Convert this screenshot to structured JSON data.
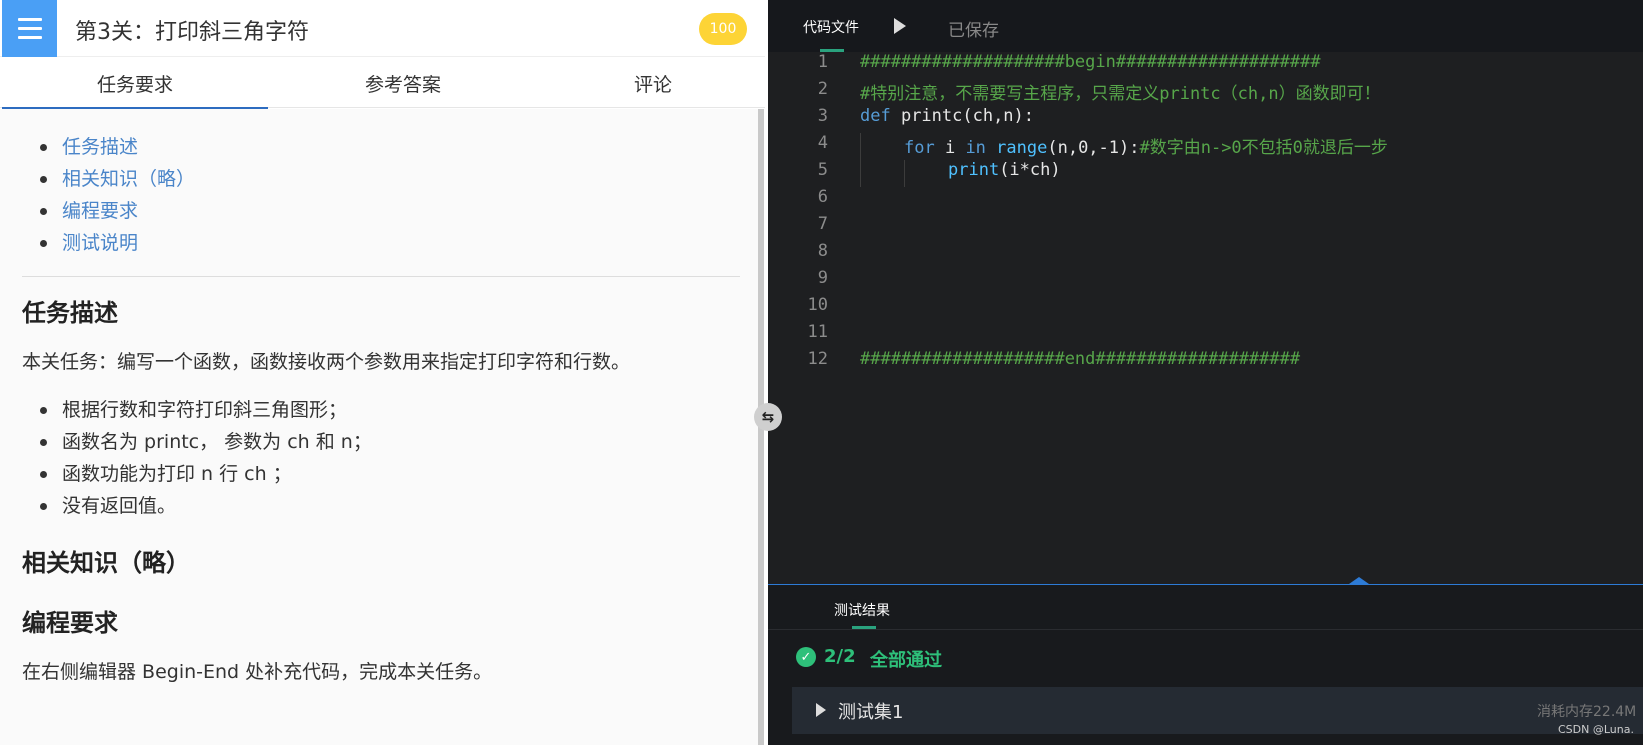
{
  "header": {
    "title": "第3关：打印斜三角字符",
    "score": "100"
  },
  "tabs": [
    "任务要求",
    "参考答案",
    "评论"
  ],
  "toc": [
    "任务描述",
    "相关知识（略）",
    "编程要求",
    "测试说明"
  ],
  "task": {
    "heading": "任务描述",
    "intro": "本关任务：编写一个函数，函数接收两个参数用来指定打印字符和行数。",
    "bullets": [
      "根据行数和字符打印斜三角图形；",
      "函数名为 printc， 参数为 ch 和 n；",
      "函数功能为打印 n 行 ch ；",
      "没有返回值。"
    ]
  },
  "knowledge": {
    "heading": "相关知识（略）"
  },
  "requirement": {
    "heading": "编程要求",
    "text": "在右侧编辑器 Begin-End 处补充代码，完成本关任务。"
  },
  "editor": {
    "file_tab": "代码文件",
    "saved_label": "已保存",
    "line_numbers": [
      "1",
      "2",
      "3",
      "4",
      "5",
      "6",
      "7",
      "8",
      "9",
      "10",
      "11",
      "12"
    ],
    "code": {
      "l1": "####################begin####################",
      "l2": "#特别注意，不需要写主程序，只需定义printc（ch,n）函数即可！",
      "l3_kw": "def",
      "l3_rest": " printc(ch,n):",
      "l4_for": "for",
      "l4_i": " i ",
      "l4_in": "in",
      "l4_sp": " ",
      "l4_range": "range",
      "l4_args": "(n,0,-1):",
      "l4_comment": "#数字由n->0不包括0就退后一步",
      "l5_print": "print",
      "l5_args": "(i*ch)",
      "l12": "####################end####################"
    }
  },
  "results": {
    "tab": "测试结果",
    "count": "2/2",
    "status": "全部通过",
    "testset_label": "测试集1",
    "memory": "消耗内存22.4M",
    "watermark": "CSDN @Luna."
  },
  "colors": {
    "accent_blue": "#4a9ff5",
    "score_yellow": "#fdd436",
    "pass_green": "#2ec07a"
  }
}
